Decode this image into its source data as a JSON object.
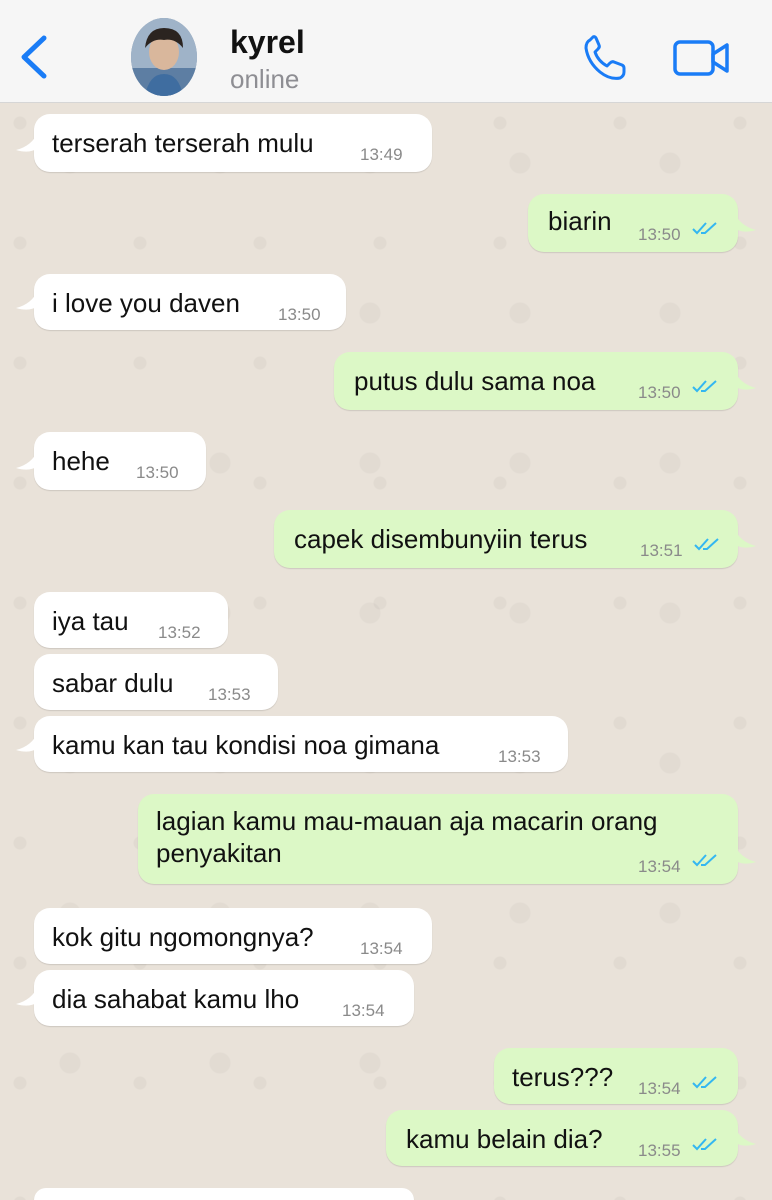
{
  "header": {
    "contact_name": "kyrel",
    "status": "online",
    "accent_color": "#1a7cf6"
  },
  "messages": [
    {
      "dir": "in",
      "text": "terserah terserah mulu",
      "time": "13:49"
    },
    {
      "dir": "out",
      "text": "biarin",
      "time": "13:50",
      "read": true
    },
    {
      "dir": "in",
      "text": "i love you daven",
      "time": "13:50"
    },
    {
      "dir": "out",
      "text": "putus dulu sama noa",
      "time": "13:50",
      "read": true
    },
    {
      "dir": "in",
      "text": "hehe",
      "time": "13:50"
    },
    {
      "dir": "out",
      "text": "capek disembunyiin terus",
      "time": "13:51",
      "read": true
    },
    {
      "dir": "in",
      "text": "iya tau",
      "time": "13:52"
    },
    {
      "dir": "in",
      "text": "sabar dulu",
      "time": "13:53"
    },
    {
      "dir": "in",
      "text": "kamu kan tau kondisi noa gimana",
      "time": "13:53"
    },
    {
      "dir": "out",
      "text": "lagian kamu mau-mauan aja macarin orang penyakitan",
      "text_line1": "lagian kamu mau-mauan aja macarin orang",
      "text_line2": "penyakitan",
      "time": "13:54",
      "read": true
    },
    {
      "dir": "in",
      "text": "kok gitu ngomongnya?",
      "time": "13:54"
    },
    {
      "dir": "in",
      "text": "dia sahabat kamu lho",
      "time": "13:54"
    },
    {
      "dir": "out",
      "text": "terus???",
      "time": "13:54",
      "read": true
    },
    {
      "dir": "out",
      "text": "kamu belain dia?",
      "time": "13:55",
      "read": true
    }
  ]
}
